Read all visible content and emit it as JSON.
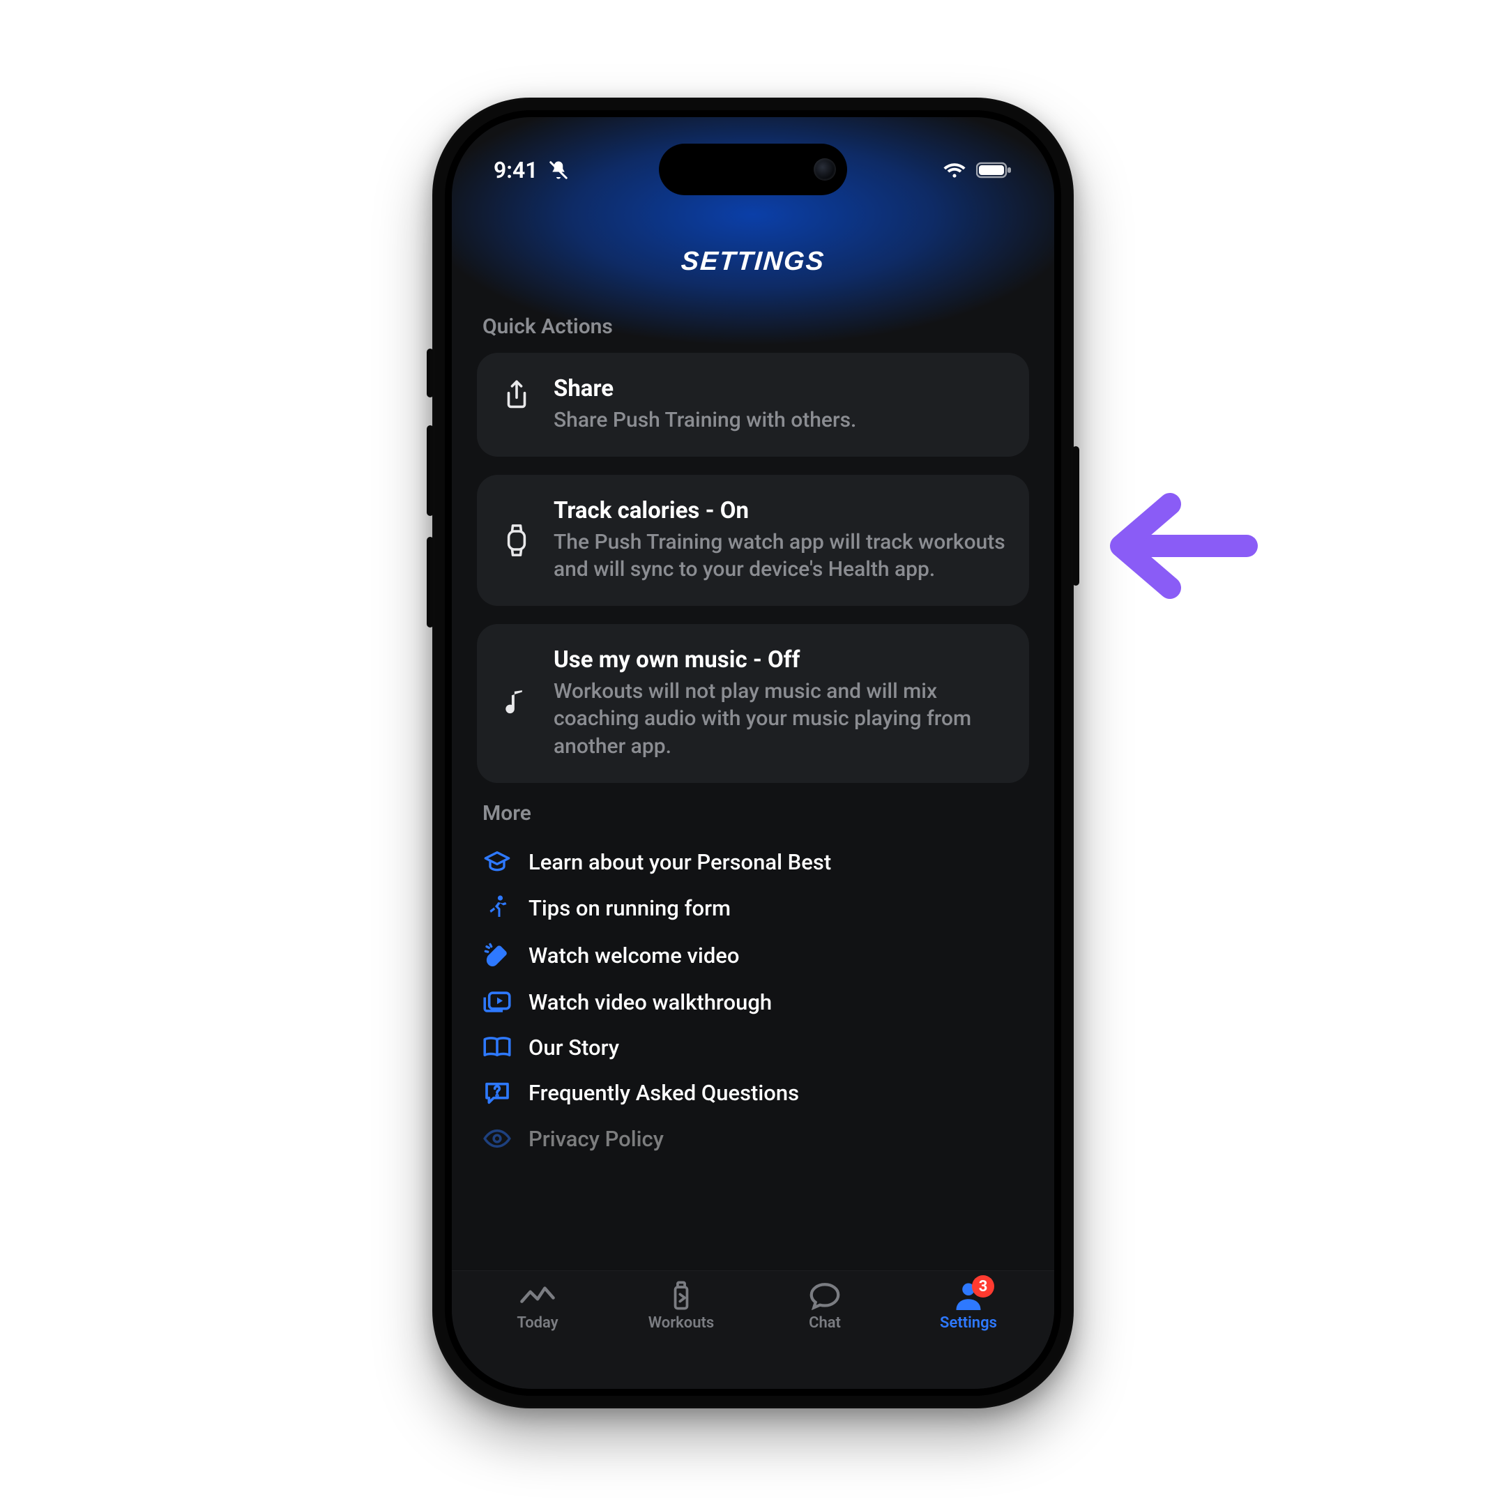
{
  "status": {
    "time": "9:41"
  },
  "page": {
    "title": "SETTINGS"
  },
  "quick_actions": {
    "label": "Quick Actions",
    "items": [
      {
        "title": "Share",
        "desc": "Share Push Training with others.",
        "icon": "share-icon"
      },
      {
        "title": "Track calories - On",
        "desc": "The Push Training watch app will track workouts and will sync to your device's Health app.",
        "icon": "watch-icon"
      },
      {
        "title": "Use my own music - Off",
        "desc": "Workouts will not play music and will mix coaching audio with your music playing from another app.",
        "icon": "music-note-icon"
      }
    ]
  },
  "more": {
    "label": "More",
    "items": [
      {
        "label": "Learn about your Personal Best",
        "icon": "grad-cap-icon"
      },
      {
        "label": "Tips on running form",
        "icon": "runner-icon"
      },
      {
        "label": "Watch welcome video",
        "icon": "clap-icon"
      },
      {
        "label": "Watch video walkthrough",
        "icon": "play-rect-icon"
      },
      {
        "label": "Our Story",
        "icon": "book-icon"
      },
      {
        "label": "Frequently Asked Questions",
        "icon": "faq-icon"
      },
      {
        "label": "Privacy Policy",
        "icon": "eye-icon"
      }
    ]
  },
  "tabs": {
    "items": [
      {
        "label": "Today",
        "icon": "chart-line-icon",
        "active": false
      },
      {
        "label": "Workouts",
        "icon": "bottle-icon",
        "active": false
      },
      {
        "label": "Chat",
        "icon": "chat-bubble-icon",
        "active": false
      },
      {
        "label": "Settings",
        "icon": "person-icon",
        "active": true,
        "badge": "3"
      }
    ]
  },
  "colors": {
    "accent_blue": "#2e79ff",
    "callout_purple": "#8a5cf6",
    "badge_red": "#ff3b30",
    "card_bg": "#1d1f22",
    "screen_bg": "#111214",
    "muted_text": "#8b8d92"
  }
}
